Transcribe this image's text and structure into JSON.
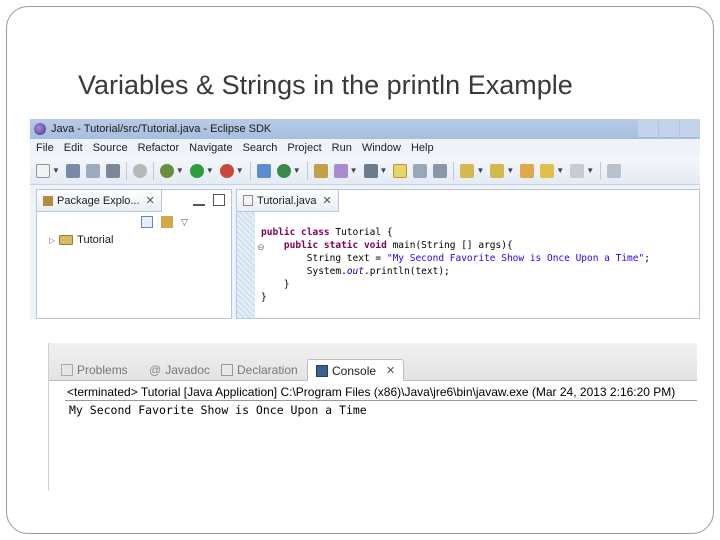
{
  "slide": {
    "title": "Variables & Strings in the println Example"
  },
  "window": {
    "title": "Java - Tutorial/src/Tutorial.java - Eclipse SDK"
  },
  "menu": {
    "items": [
      "File",
      "Edit",
      "Source",
      "Refactor",
      "Navigate",
      "Search",
      "Project",
      "Run",
      "Window",
      "Help"
    ]
  },
  "package_explorer": {
    "tab_label": "Package Explo...",
    "tree": [
      {
        "label": "Tutorial"
      }
    ]
  },
  "editor": {
    "tab_label": "Tutorial.java",
    "code": {
      "l1_kw": "public class ",
      "l1_rest": "Tutorial {",
      "l2_kw": "public static void ",
      "l2_rest": "main(String [] args){",
      "l3_pre": "String text = ",
      "l3_str": "\"My Second Favorite Show is Once Upon a Time\"",
      "l3_post": ";",
      "l4_pre": "System.",
      "l4_fld": "out",
      "l4_post": ".println(text);",
      "l5": "}",
      "l6": "}"
    }
  },
  "console": {
    "tabs": [
      {
        "label": "Problems",
        "icon": "problems-icon"
      },
      {
        "label": "Javadoc",
        "icon": "at-icon"
      },
      {
        "label": "Declaration",
        "icon": "declaration-icon"
      },
      {
        "label": "Console",
        "icon": "console-icon"
      }
    ],
    "terminated_line": "<terminated> Tutorial [Java Application] C:\\Program Files (x86)\\Java\\jre6\\bin\\javaw.exe (Mar 24, 2013 2:16:20 PM)",
    "output": "My Second Favorite Show is Once Upon a Time"
  },
  "colors": {
    "keyword": "#7f0055",
    "string": "#2a00ff",
    "field": "#0000c0"
  }
}
